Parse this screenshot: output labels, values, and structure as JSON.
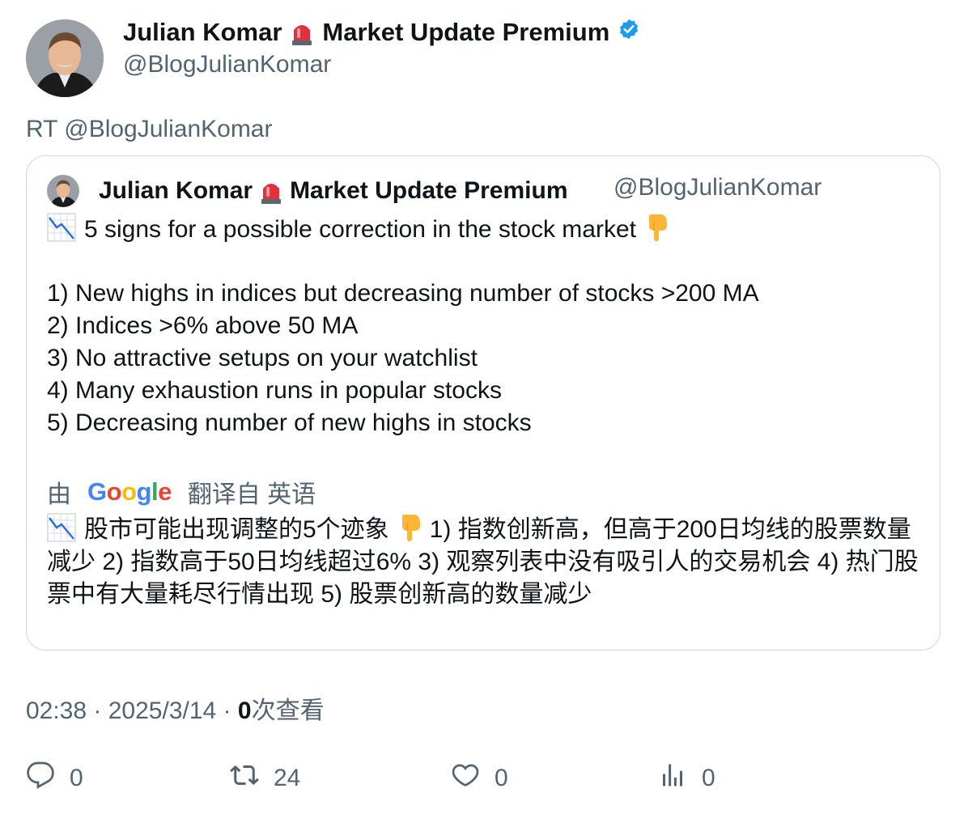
{
  "author": {
    "display_name": "Julian Komar",
    "name_suffix": "Market Update Premium",
    "handle": "@BlogJulianKomar"
  },
  "retweet_line": "RT @BlogJulianKomar",
  "quote": {
    "display_name": "Julian Komar",
    "name_suffix": "Market Update Premium",
    "handle": "@BlogJulianKomar",
    "headline": "5 signs for a possible correction in the stock market",
    "lines": [
      "1) New highs in indices but decreasing number of stocks >200 MA",
      "2) Indices >6% above 50 MA",
      "3) No attractive setups on your watchlist",
      "4) Many exhaustion runs in popular stocks",
      "5) Decreasing number of new highs in stocks"
    ],
    "translated_prefix": "由",
    "translator_logo": "Google",
    "translated_suffix": "翻译自 英语",
    "translation_text": "股市可能出现调整的5个迹象",
    "translation_rest": "1) 指数创新高，但高于200日均线的股票数量减少 2) 指数高于50日均线超过6% 3) 观察列表中没有吸引人的交易机会 4) 热门股票中有大量耗尽行情出现 5) 股票创新高的数量减少"
  },
  "meta": {
    "time": "02:38",
    "date": "2025/3/14",
    "views_count": "0",
    "views_label": "次查看"
  },
  "actions": {
    "reply_count": "0",
    "retweet_count": "24",
    "like_count": "0",
    "views_count": "0"
  },
  "colors": {
    "verified": "#1d9bf0",
    "muted": "#536471",
    "border": "#cfd9de"
  },
  "icons": [
    "siren-icon",
    "verified-badge-icon",
    "chart-decreasing-icon",
    "pointing-down-icon",
    "reply-icon",
    "retweet-icon",
    "like-icon",
    "views-icon"
  ]
}
